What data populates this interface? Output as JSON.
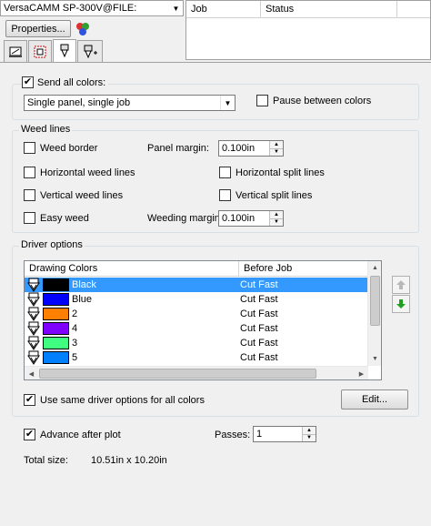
{
  "device": {
    "selected": "VersaCAMM SP-300V@FILE:"
  },
  "toolbar": {
    "properties_label": "Properties..."
  },
  "job_table": {
    "columns": [
      "Job",
      "Status"
    ]
  },
  "colors_section": {
    "send_all_label": "Send all colors:",
    "send_all_checked": true,
    "mode_value": "Single panel, single job",
    "pause_label": "Pause between colors",
    "pause_checked": false
  },
  "weed_lines": {
    "title": "Weed lines",
    "weed_border": "Weed border",
    "panel_margin_label": "Panel margin:",
    "panel_margin_value": "0.100in",
    "horizontal_weed": "Horizontal weed lines",
    "horizontal_split": "Horizontal split lines",
    "vertical_weed": "Vertical weed lines",
    "vertical_split": "Vertical split lines",
    "easy_weed": "Easy weed",
    "weeding_margin_label": "Weeding margin:",
    "weeding_margin_value": "0.100in"
  },
  "driver_options": {
    "title": "Driver options",
    "columns": [
      "Drawing Colors",
      "Before Job"
    ],
    "rows": [
      {
        "name": "Black",
        "color": "#000000",
        "action": "Cut Fast",
        "selected": true
      },
      {
        "name": "Blue",
        "color": "#0000ff",
        "action": "Cut Fast",
        "selected": false
      },
      {
        "name": "2",
        "color": "#ff8000",
        "action": "Cut Fast",
        "selected": false
      },
      {
        "name": "4",
        "color": "#8000ff",
        "action": "Cut Fast",
        "selected": false
      },
      {
        "name": "3",
        "color": "#40ff80",
        "action": "Cut Fast",
        "selected": false
      },
      {
        "name": "5",
        "color": "#0080ff",
        "action": "Cut Fast",
        "selected": false
      }
    ],
    "same_options_label": "Use same driver options for all colors",
    "same_options_checked": true,
    "edit_label": "Edit..."
  },
  "footer": {
    "advance_label": "Advance after plot",
    "advance_checked": true,
    "passes_label": "Passes:",
    "passes_value": "1",
    "total_size_label": "Total size:",
    "total_size_value": "10.51in x 10.20in"
  }
}
